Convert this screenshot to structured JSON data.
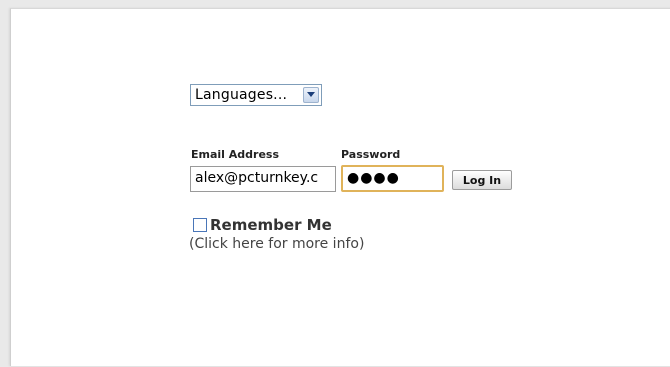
{
  "language_select": {
    "selected": "Languages...",
    "icon": "chevron-down-icon"
  },
  "login": {
    "email_label": "Email Address",
    "password_label": "Password",
    "email_value": "alex@pcturnkey.c",
    "password_value": "●●●●",
    "login_button": "Log In"
  },
  "remember": {
    "label": "Remember Me",
    "checked": false,
    "info_link": "(Click here for more info)"
  },
  "colors": {
    "password_focus_border": "#e0b35a",
    "checkbox_border": "#4a76b8",
    "select_border": "#7f9db9"
  }
}
